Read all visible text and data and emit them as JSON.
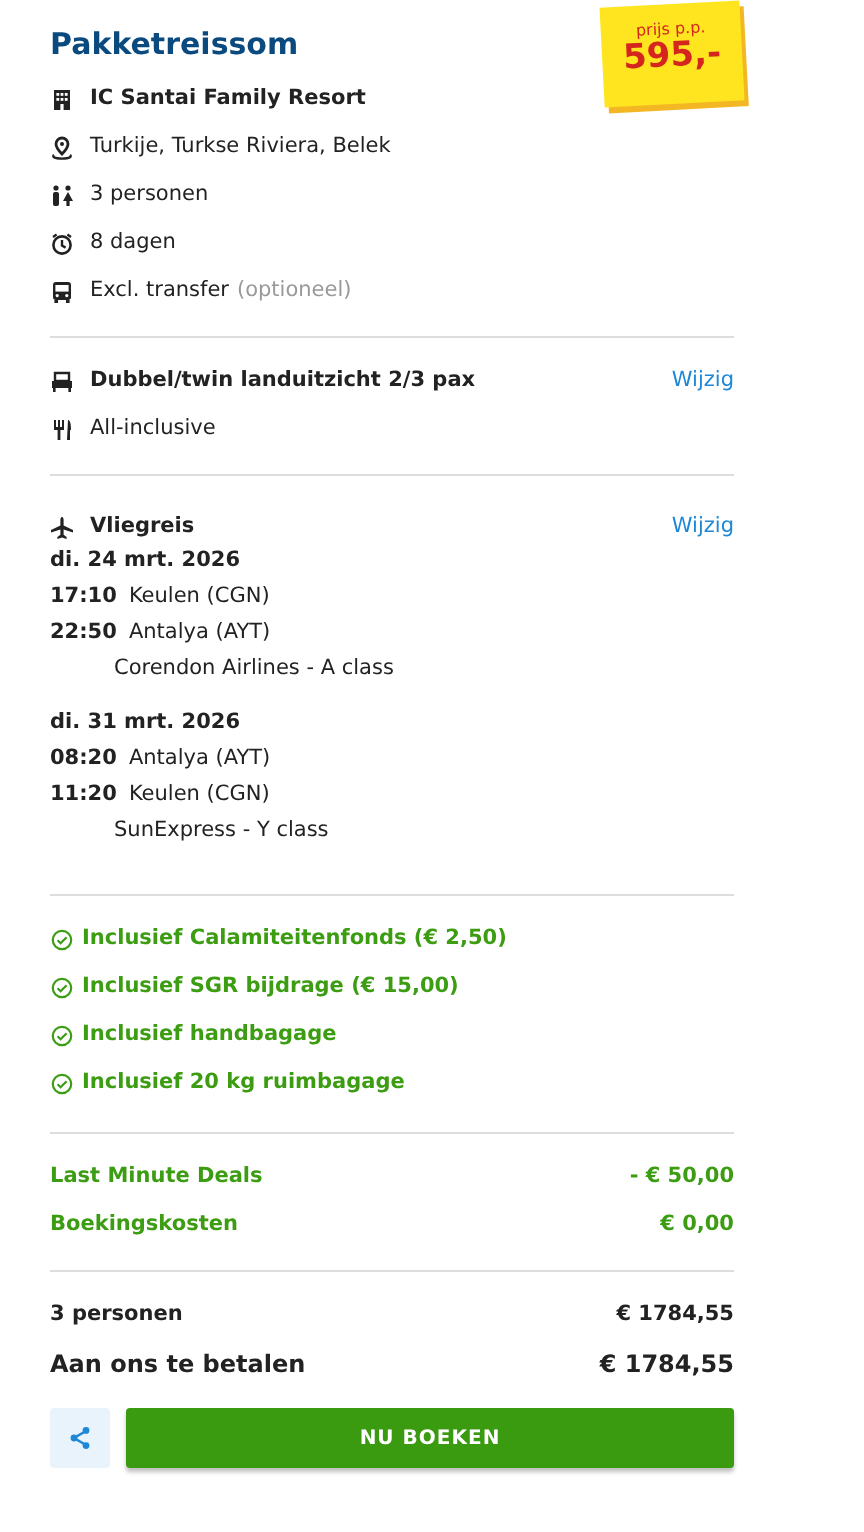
{
  "title": "Pakketreissom",
  "price_tag": {
    "label": "prijs p.p.",
    "amount": "595,-"
  },
  "details": [
    {
      "kind": "hotel",
      "text": "IC Santai Family Resort",
      "bold": true
    },
    {
      "kind": "location",
      "text": "Turkije, Turkse Riviera, Belek",
      "bold": false
    },
    {
      "kind": "persons",
      "text": "3 personen",
      "bold": false
    },
    {
      "kind": "duration",
      "text": "8 dagen",
      "bold": false
    },
    {
      "kind": "bus",
      "text": "Excl. transfer",
      "note": "(optioneel)",
      "bold": false
    }
  ],
  "room": {
    "text": "Dubbel/twin landuitzicht 2/3 pax",
    "meal": "All-inclusive",
    "link": "Wijzig"
  },
  "flight": {
    "title": "Vliegreis",
    "link": "Wijzig",
    "legs": [
      {
        "date": "di. 24 mrt. 2026",
        "segments": [
          {
            "time": "17:10",
            "place": "Keulen (CGN)"
          },
          {
            "time": "22:50",
            "place": "Antalya (AYT)"
          }
        ],
        "carrier": "Corendon Airlines - A class"
      },
      {
        "date": "di. 31 mrt. 2026",
        "segments": [
          {
            "time": "08:20",
            "place": "Antalya (AYT)"
          },
          {
            "time": "11:20",
            "place": "Keulen (CGN)"
          }
        ],
        "carrier": "SunExpress - Y class"
      }
    ]
  },
  "inclusions": [
    "Inclusief Calamiteitenfonds (€ 2,50)",
    "Inclusief SGR bijdrage (€ 15,00)",
    "Inclusief handbagage",
    "Inclusief 20 kg ruimbagage"
  ],
  "adjustments": [
    {
      "label": "Last Minute Deals",
      "amount": "- € 50,00"
    },
    {
      "label": "Boekingskosten",
      "amount": "€ 0,00"
    }
  ],
  "totals": [
    {
      "kind": "subtotal",
      "label": "3 personen",
      "amount": "€ 1784,55"
    },
    {
      "kind": "grand",
      "label": "Aan ons te betalen",
      "amount": "€ 1784,55"
    }
  ],
  "book_button": "NU BOEKEN"
}
